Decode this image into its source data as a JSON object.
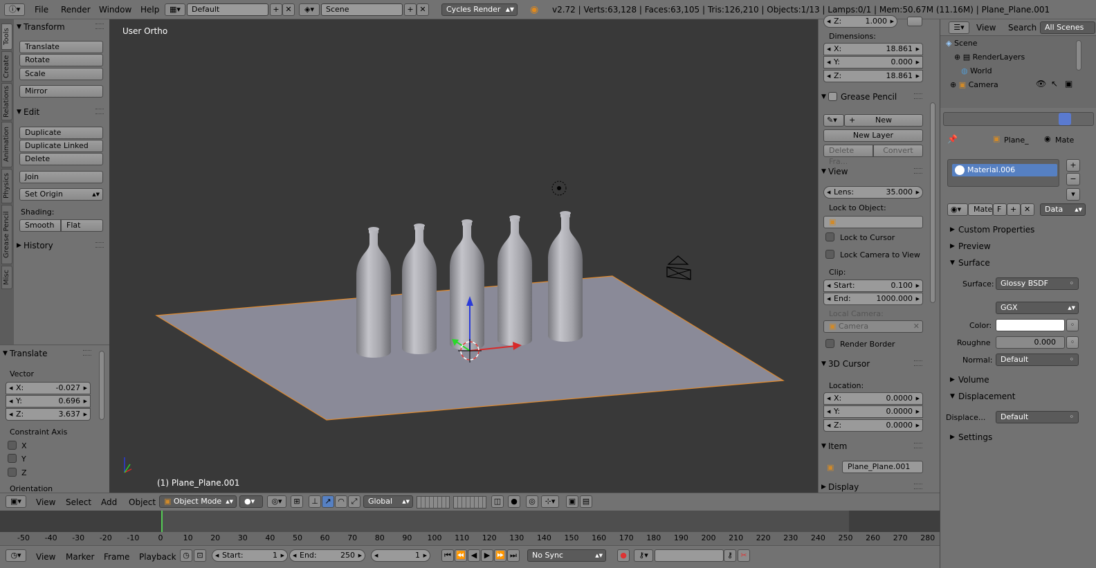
{
  "topbar": {
    "menus": [
      "File",
      "Render",
      "Window",
      "Help"
    ],
    "layout": "Default",
    "scene": "Scene",
    "engine": "Cycles Render",
    "stats": "v2.72 | Verts:63,128 | Faces:63,105 | Tris:126,210 | Objects:1/13 | Lamps:0/1 | Mem:50.67M (11.16M) | Plane_Plane.001"
  },
  "vtabs": [
    "Tools",
    "Create",
    "Relations",
    "Animation",
    "Physics",
    "Grease Pencil",
    "Misc"
  ],
  "toolshelf": {
    "transform_title": "Transform",
    "translate": "Translate",
    "rotate": "Rotate",
    "scale": "Scale",
    "mirror": "Mirror",
    "edit_title": "Edit",
    "duplicate": "Duplicate",
    "duplicate_linked": "Duplicate Linked",
    "delete": "Delete",
    "join": "Join",
    "set_origin": "Set Origin",
    "shading_label": "Shading:",
    "smooth": "Smooth",
    "flat": "Flat",
    "history_title": "History"
  },
  "operator": {
    "title": "Translate",
    "vector_label": "Vector",
    "x_key": "X:",
    "x_val": "-0.027",
    "y_key": "Y:",
    "y_val": "0.696",
    "z_key": "Z:",
    "z_val": "3.637",
    "constraint_label": "Constraint Axis",
    "axis_x": "X",
    "axis_y": "Y",
    "axis_z": "Z",
    "orientation_label": "Orientation"
  },
  "viewport": {
    "title": "User Ortho",
    "object_label": "(1) Plane_Plane.001"
  },
  "npanel": {
    "z_top_key": "Z:",
    "z_top_val": "1.000",
    "dimensions_label": "Dimensions:",
    "dim_x_key": "X:",
    "dim_x_val": "18.861",
    "dim_y_key": "Y:",
    "dim_y_val": "0.000",
    "dim_z_key": "Z:",
    "dim_z_val": "18.861",
    "grease_title": "Grease Pencil",
    "new": "New",
    "new_layer": "New Layer",
    "delete_frame": "Delete Fra...",
    "convert": "Convert",
    "view_title": "View",
    "lens_key": "Lens:",
    "lens_val": "35.000",
    "lock_to_object": "Lock to Object:",
    "lock_cursor": "Lock to Cursor",
    "lock_camera": "Lock Camera to View",
    "clip_label": "Clip:",
    "start_key": "Start:",
    "start_val": "0.100",
    "end_key": "End:",
    "end_val": "1000.000",
    "local_camera": "Local Camera:",
    "camera": "Camera",
    "render_border": "Render Border",
    "cursor_title": "3D Cursor",
    "location_label": "Location:",
    "cx_key": "X:",
    "cx_val": "0.0000",
    "cy_key": "Y:",
    "cy_val": "0.0000",
    "cz_key": "Z:",
    "cz_val": "0.0000",
    "item_title": "Item",
    "item_name": "Plane_Plane.001",
    "display_title": "Display"
  },
  "outliner": {
    "view": "View",
    "search": "Search",
    "all_scenes": "All Scenes",
    "items": [
      "Scene",
      "RenderLayers",
      "World",
      "Camera"
    ]
  },
  "props": {
    "breadcrumb_obj": "Plane_",
    "breadcrumb_mat": "Mate",
    "material_slot": "Material.006",
    "mat_short": "Mate",
    "mat_f": "F",
    "data": "Data",
    "custom_props": "Custom Properties",
    "preview": "Preview",
    "surface_title": "Surface",
    "surface_label": "Surface:",
    "surface_value": "Glossy BSDF",
    "distribution": "GGX",
    "color_label": "Color:",
    "color_value": "#ffffff",
    "roughness_label": "Roughne",
    "roughness_value": "0.000",
    "normal_label": "Normal:",
    "normal_value": "Default",
    "volume_title": "Volume",
    "displacement_title": "Displacement",
    "displace_label": "Displace...",
    "displace_value": "Default",
    "settings_title": "Settings"
  },
  "vphdr": {
    "view": "View",
    "select": "Select",
    "add": "Add",
    "object": "Object",
    "mode": "Object Mode",
    "orientation": "Global"
  },
  "timeline": {
    "ticks": [
      "-50",
      "-40",
      "-30",
      "-20",
      "-10",
      "0",
      "10",
      "20",
      "30",
      "40",
      "50",
      "60",
      "70",
      "80",
      "90",
      "100",
      "110",
      "120",
      "130",
      "140",
      "150",
      "160",
      "170",
      "180",
      "190",
      "200",
      "210",
      "220",
      "230",
      "240",
      "250",
      "260",
      "270",
      "280"
    ],
    "view": "View",
    "marker": "Marker",
    "frame": "Frame",
    "playback": "Playback",
    "start_key": "Start:",
    "start_val": "1",
    "end_key": "End:",
    "end_val": "250",
    "current": "1",
    "sync": "No Sync"
  }
}
